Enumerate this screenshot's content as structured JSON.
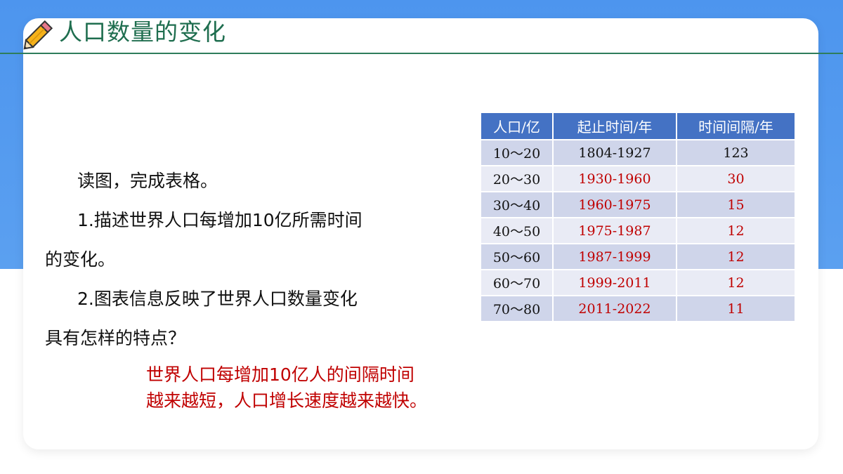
{
  "header": {
    "title": "人口数量的变化"
  },
  "question": {
    "intro": "读图，完成表格。",
    "q1_line1": "1.描述世界人口每增加10亿所需时间",
    "q1_line2": "的变化。",
    "q2_line1": "2.图表信息反映了世界人口数量变化",
    "q2_line2": "具有怎样的特点？"
  },
  "answer": {
    "line1": "世界人口每增加10亿人的间隔时间",
    "line2": "越来越短，人口增长速度越来越快。"
  },
  "table": {
    "headers": [
      "人口/亿",
      "起止时间/年",
      "时间间隔/年"
    ],
    "rows": [
      [
        "10～20",
        "1804-1927",
        "123"
      ],
      [
        "20～30",
        "1930-1960",
        "30"
      ],
      [
        "30～40",
        "1960-1975",
        "15"
      ],
      [
        "40～50",
        "1975-1987",
        "12"
      ],
      [
        "50～60",
        "1987-1999",
        "12"
      ],
      [
        "60～70",
        "1999-2011",
        "12"
      ],
      [
        "70～80",
        "2011-2022",
        "11"
      ]
    ]
  },
  "colors": {
    "band": "#5ba0f0",
    "title": "#1f6e4f",
    "table_header": "#4472c4",
    "answer_text": "#c00000"
  }
}
